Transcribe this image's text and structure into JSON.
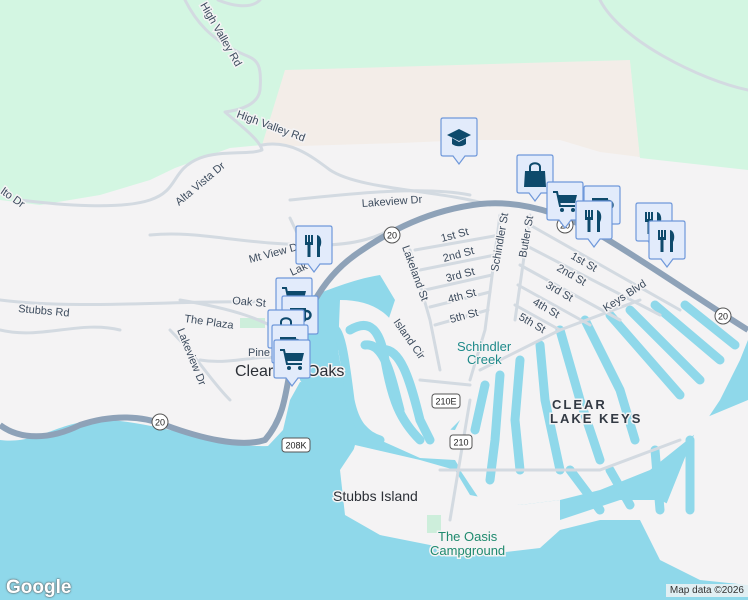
{
  "colors": {
    "land": "#f4f3f4",
    "park": "#d3f6e2",
    "sand": "#f3ede8",
    "water": "#8fd8ea",
    "highway": "#8ea2b8",
    "road": "#d3dae1",
    "pin_fill": "#e2ebfb",
    "pin_icon": "#0e4a6c"
  },
  "places": {
    "town": "Clearlake Oaks",
    "district_line1": "CLEAR",
    "district_line2": "LAKE KEYS",
    "island": "Stubbs Island",
    "creek_line1": "Schindler",
    "creek_line2": "Creek",
    "campground_line1": "The Oasis",
    "campground_line2": "Campground"
  },
  "streets": {
    "high_valley_1": "High Valley Rd",
    "high_valley_2": "High Valley Rd",
    "alta_vista": "Alta Vista Dr",
    "lito": "lto Dr",
    "lakeview": "Lakeview Dr",
    "mt_view": "Mt View Dr",
    "lak": "Lak",
    "stubbs": "Stubbs Rd",
    "oak": "Oak St",
    "plaza": "The Plaza",
    "lakeview_dr2": "Lakeview Dr",
    "pine": "Pine",
    "lakeland": "Lakeland St",
    "schindler": "Schindler St",
    "butler": "Butler St",
    "first_w": "1st St",
    "second_w": "2nd St",
    "third_w": "3rd St",
    "fourth_w": "4th St",
    "fifth_w": "5th St",
    "first_e": "1st St",
    "second_e": "2nd St",
    "third_e": "3rd St",
    "fourth_e": "4th St",
    "fifth_e": "5th St",
    "keys_blvd": "Keys Blvd",
    "island_cir": "Island Cir"
  },
  "shields": {
    "r20a": "20",
    "r20b": "20",
    "r20c": "20",
    "r20d": "20",
    "r210e": "210E",
    "r210": "210",
    "r208k": "208K"
  },
  "pins": [
    {
      "type": "school-icon"
    },
    {
      "type": "restaurant-icon"
    },
    {
      "type": "shopping-bag-icon"
    },
    {
      "type": "grocery-cart-icon"
    },
    {
      "type": "cafe-icon"
    },
    {
      "type": "restaurant-icon"
    },
    {
      "type": "restaurant-icon"
    },
    {
      "type": "restaurant-icon"
    },
    {
      "type": "grocery-cart-icon"
    },
    {
      "type": "cafe-icon"
    },
    {
      "type": "shopping-bag-icon"
    },
    {
      "type": "cafe-icon"
    },
    {
      "type": "grocery-cart-icon"
    }
  ],
  "footer": {
    "logo": "Google",
    "attribution": "Map data ©2026"
  }
}
